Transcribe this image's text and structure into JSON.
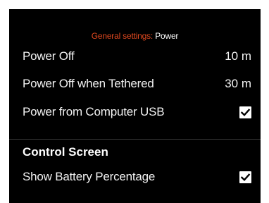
{
  "breadcrumb": {
    "parent": "General settings:",
    "current": "Power"
  },
  "settings": [
    {
      "label": "Power Off",
      "value": "10 m"
    },
    {
      "label": "Power Off when Tethered",
      "value": "30 m"
    },
    {
      "label": "Power from Computer USB",
      "checked": true
    }
  ],
  "control_screen": {
    "title": "Control Screen",
    "items": [
      {
        "label": "Show Battery Percentage",
        "checked": true
      }
    ]
  },
  "colors": {
    "background": "#000000",
    "accent": "#e0481f",
    "text": "#f2f2f2",
    "checkbox": "#ffffff"
  }
}
